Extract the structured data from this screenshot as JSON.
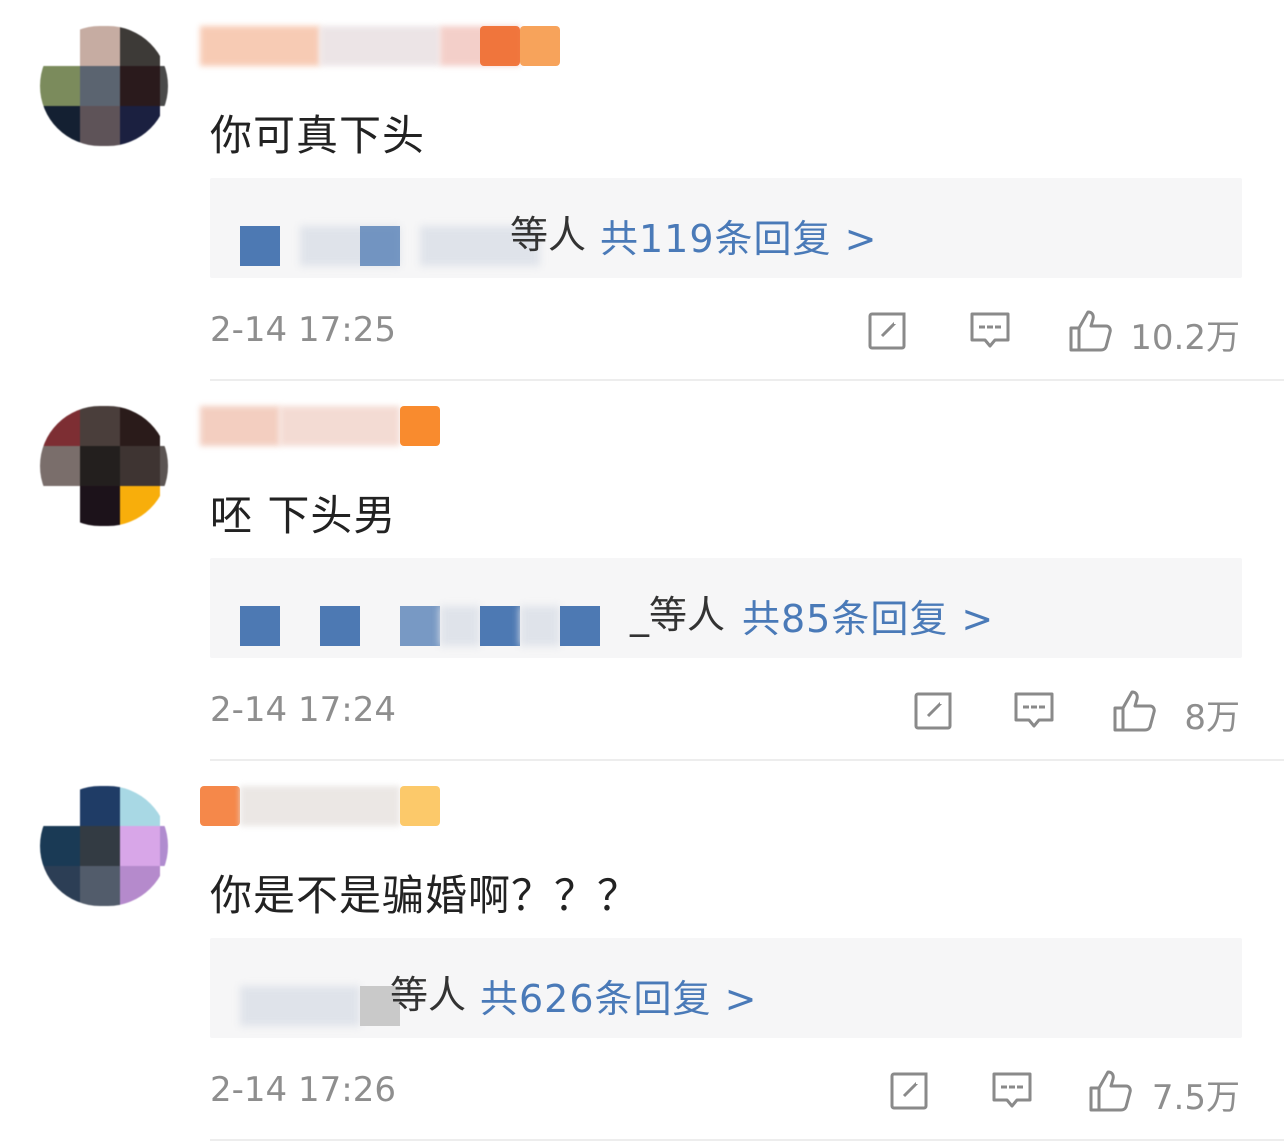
{
  "comments": [
    {
      "content": "你可真下头",
      "reply_suffix": "等人",
      "reply_count": "共119条回复 >",
      "timestamp": "2-14 17:25",
      "likes": "10.2万"
    },
    {
      "content": "呸 下头男",
      "reply_suffix": "_等人",
      "reply_count": "共85条回复 >",
      "timestamp": "2-14 17:24",
      "likes": "8万"
    },
    {
      "content": "你是不是骗婚啊？？？",
      "reply_suffix": "等人",
      "reply_count": "共626条回复 >",
      "timestamp": "2-14 17:26",
      "likes": "7.5万"
    }
  ],
  "colors": {
    "link_blue": "#4a7ab8",
    "meta_grey": "#8e8e8e",
    "reply_box_bg": "#f6f6f7"
  },
  "icons": [
    "share-icon",
    "comment-icon",
    "like-icon"
  ]
}
